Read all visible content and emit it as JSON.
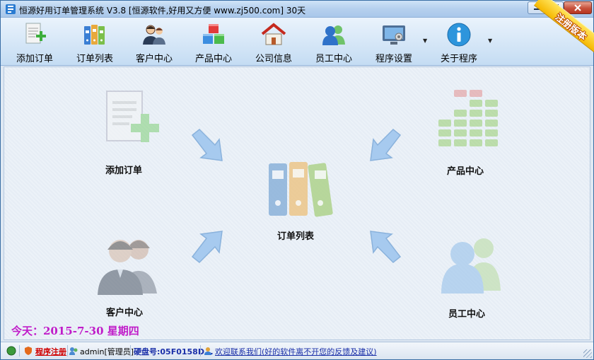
{
  "window": {
    "title": "恒源好用订单管理系统 V3.8  [恒源软件,好用又方便 www.zj500.com]  30天"
  },
  "toolbar": {
    "items": [
      {
        "label": "添加订单",
        "icon": "add-order-icon"
      },
      {
        "label": "订单列表",
        "icon": "binders-icon"
      },
      {
        "label": "客户中心",
        "icon": "customers-icon"
      },
      {
        "label": "产品中心",
        "icon": "cubes-icon"
      },
      {
        "label": "公司信息",
        "icon": "house-icon"
      },
      {
        "label": "员工中心",
        "icon": "staff-icon"
      },
      {
        "label": "程序设置",
        "icon": "settings-monitor-icon"
      },
      {
        "label": "关于程序",
        "icon": "info-icon"
      }
    ],
    "ribbon": "注册版本"
  },
  "modules": {
    "add_order": "添加订单",
    "order_list": "订单列表",
    "product_center": "产品中心",
    "customer_center": "客户中心",
    "staff_center": "员工中心"
  },
  "date_line": "今天：2015-7-30  星期四",
  "status": {
    "register": "程序注册",
    "user": "admin[管理员]",
    "disk": "硬盘号:05F0158D...",
    "feedback": "欢迎联系我们(好的软件离不开您的反馈及建议)"
  },
  "colors": {
    "accent": "#3a6ea5",
    "date": "#c01cc9",
    "register": "#d00000",
    "link": "#1a2fa8"
  }
}
